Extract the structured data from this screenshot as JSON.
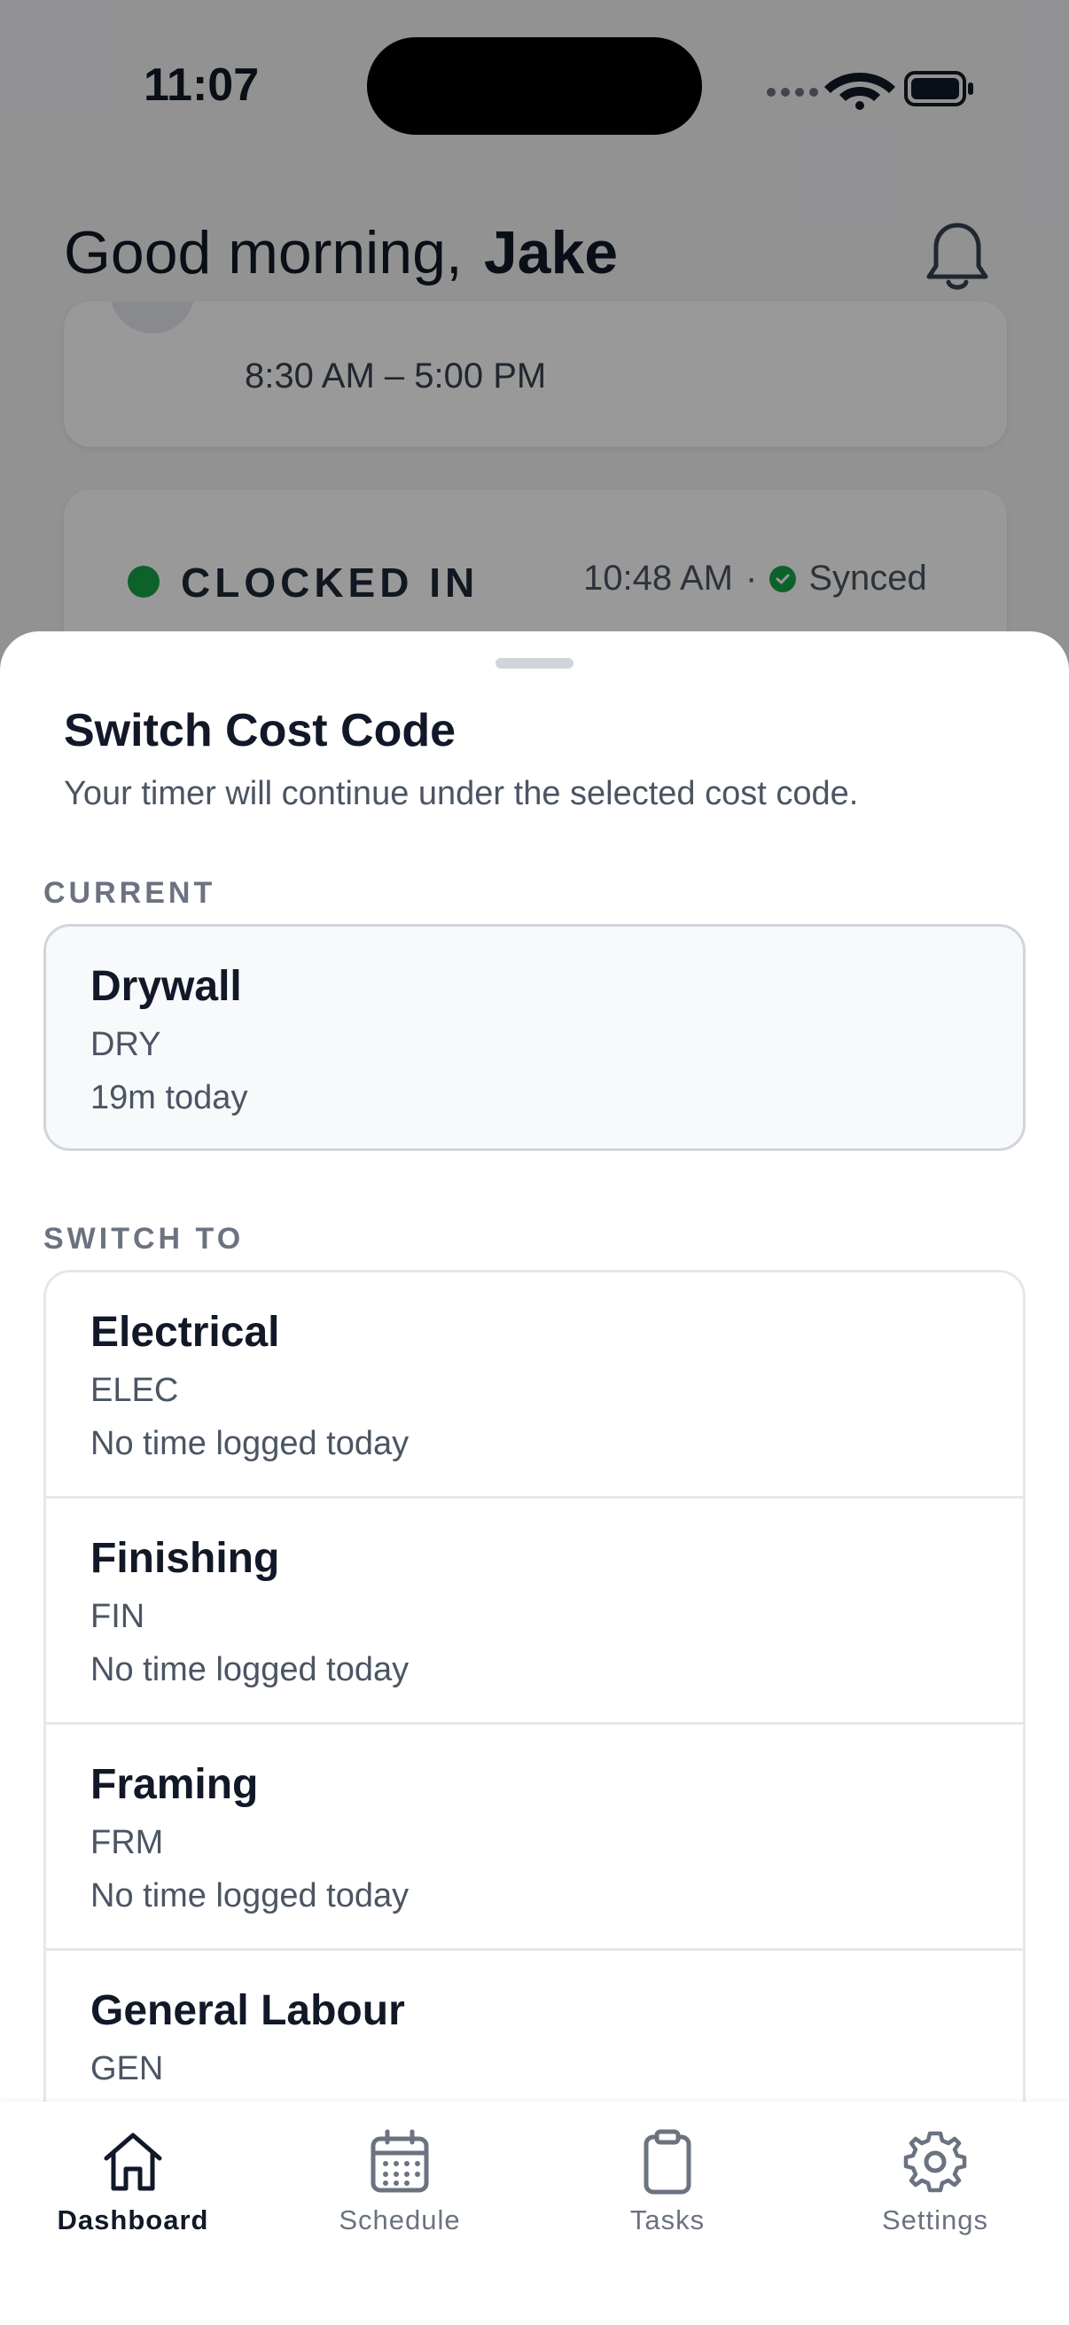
{
  "status_bar": {
    "time": "11:07"
  },
  "dashboard": {
    "greeting": "Good morning,",
    "user_name": "Jake",
    "shift_hours": "8:30 AM – 5:00 PM",
    "clock_status": "CLOCKED IN",
    "clock_time": "10:48 AM",
    "separator": "·",
    "sync_status": "Synced"
  },
  "sheet": {
    "title": "Switch Cost Code",
    "subtitle": "Your timer will continue under the selected cost code.",
    "current_label": "CURRENT",
    "current": {
      "name": "Drywall",
      "code": "DRY",
      "time": "19m today"
    },
    "switch_label": "SWITCH TO",
    "options": [
      {
        "name": "Electrical",
        "code": "ELEC",
        "time": "No time logged today"
      },
      {
        "name": "Finishing",
        "code": "FIN",
        "time": "No time logged today"
      },
      {
        "name": "Framing",
        "code": "FRM",
        "time": "No time logged today"
      },
      {
        "name": "General Labour",
        "code": "GEN",
        "time": ""
      }
    ]
  },
  "tabbar": {
    "tabs": [
      {
        "label": "Dashboard",
        "icon": "house-icon",
        "active": true
      },
      {
        "label": "Schedule",
        "icon": "calendar-icon",
        "active": false
      },
      {
        "label": "Tasks",
        "icon": "clipboard-icon",
        "active": false
      },
      {
        "label": "Settings",
        "icon": "gear-icon",
        "active": false
      }
    ]
  },
  "colors": {
    "accent_green": "#16a34a",
    "text_primary": "#111827",
    "text_secondary": "#4b5563"
  }
}
